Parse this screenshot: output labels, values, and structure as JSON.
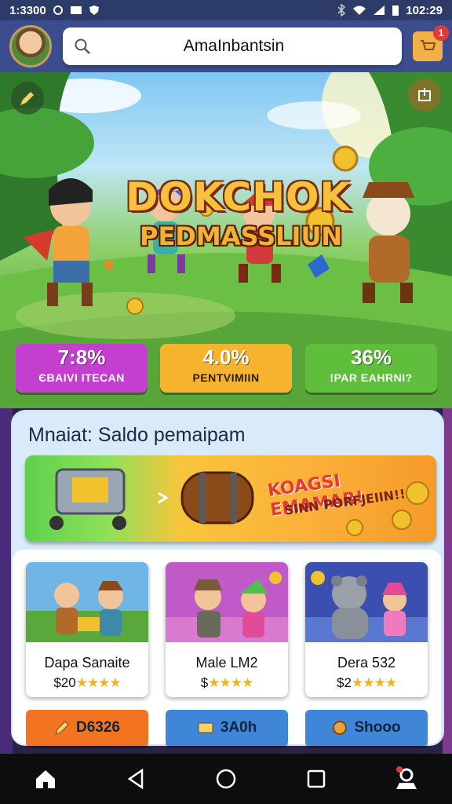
{
  "status": {
    "time_left": "1:3300",
    "time_right": "102:29"
  },
  "header": {
    "search_value": "AmaInbantsin",
    "cart_badge": "1"
  },
  "hero": {
    "title_line1": "DOKCHOK",
    "title_line2": "PEDMASSLIUN"
  },
  "stats": [
    {
      "value": "7:8%",
      "label": "ЄBAIVI ITECAN",
      "color": "#c43fd0"
    },
    {
      "value": "4.0%",
      "label": "PENTVIMIIN",
      "color": "#f6b32d"
    },
    {
      "value": "36%",
      "label": "!PAR EAHRNI?",
      "color": "#5fbf3c"
    }
  ],
  "panel": {
    "title": "Mnaiat: Saldo pemaipam",
    "banner_line1": "KOAGSI EMAMAR!",
    "banner_line2": "SINN PORFJEIIN!!"
  },
  "cards": [
    {
      "name": "Dapa Sanaite",
      "price": "$20"
    },
    {
      "name": "Male LM2",
      "price": "$"
    },
    {
      "name": "Dera 532",
      "price": "$2"
    }
  ],
  "actions": [
    {
      "label": "D6326",
      "color": "#f27420",
      "icon": "pencil-icon"
    },
    {
      "label": "3A0h",
      "color": "#3f86d8",
      "icon": "ticket-icon"
    },
    {
      "label": "Shooo",
      "color": "#3f86d8",
      "icon": "coin-icon"
    }
  ],
  "stars": "★★★★"
}
